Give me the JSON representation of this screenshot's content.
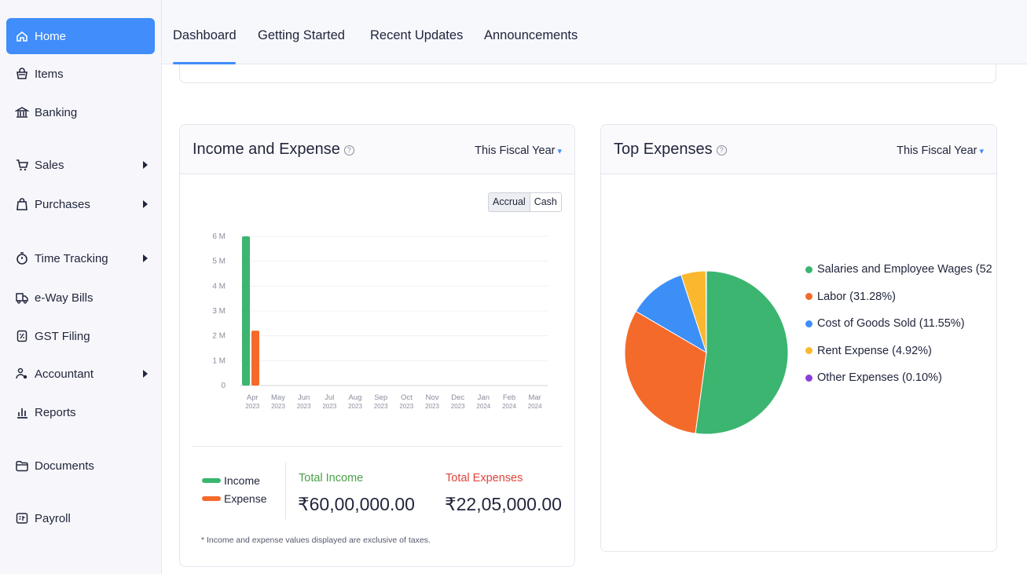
{
  "sidebar": {
    "items": [
      {
        "label": "Home",
        "icon": "home-icon",
        "active": true,
        "arrow": false
      },
      {
        "label": "Items",
        "icon": "basket-icon",
        "active": false,
        "arrow": false
      },
      {
        "label": "Banking",
        "icon": "bank-icon",
        "active": false,
        "arrow": false
      },
      {
        "label": "Sales",
        "icon": "cart-icon",
        "active": false,
        "arrow": true
      },
      {
        "label": "Purchases",
        "icon": "bag-icon",
        "active": false,
        "arrow": true
      },
      {
        "label": "Time Tracking",
        "icon": "stopwatch-icon",
        "active": false,
        "arrow": true
      },
      {
        "label": "e-Way Bills",
        "icon": "truck-icon",
        "active": false,
        "arrow": false
      },
      {
        "label": "GST Filing",
        "icon": "percent-doc-icon",
        "active": false,
        "arrow": false
      },
      {
        "label": "Accountant",
        "icon": "accountant-icon",
        "active": false,
        "arrow": true
      },
      {
        "label": "Reports",
        "icon": "bar-chart-icon",
        "active": false,
        "arrow": false
      },
      {
        "label": "Documents",
        "icon": "folder-icon",
        "active": false,
        "arrow": false
      },
      {
        "label": "Payroll",
        "icon": "payroll-icon",
        "active": false,
        "arrow": false
      }
    ]
  },
  "tabs": [
    "Dashboard",
    "Getting Started",
    "Recent Updates",
    "Announcements"
  ],
  "active_tab": "Dashboard",
  "income_card": {
    "title": "Income and Expense",
    "period": "This Fiscal Year",
    "toggle": [
      "Accrual",
      "Cash"
    ],
    "legend_income": "Income",
    "legend_expense": "Expense",
    "total_income_label": "Total Income",
    "total_income_value": "₹60,00,000.00",
    "total_expenses_label": "Total Expenses",
    "total_expenses_value": "₹22,05,000.00",
    "footnote": "* Income and expense values displayed are exclusive of taxes."
  },
  "expenses_card": {
    "title": "Top Expenses",
    "period": "This Fiscal Year"
  },
  "colors": {
    "accent": "#408dfb",
    "income": "#3bb56f",
    "expense": "#f46a2a",
    "income_label": "#4aa048",
    "expense_label": "#e0433a"
  },
  "chart_data": [
    {
      "type": "bar",
      "categories": [
        "Apr 2023",
        "May 2023",
        "Jun 2023",
        "Jul 2023",
        "Aug 2023",
        "Sep 2023",
        "Oct 2023",
        "Nov 2023",
        "Dec 2023",
        "Jan 2024",
        "Feb 2024",
        "Mar 2024"
      ],
      "series": [
        {
          "name": "Income",
          "color": "#3bb56f",
          "values": [
            6000000,
            0,
            0,
            0,
            0,
            0,
            0,
            0,
            0,
            0,
            0,
            0
          ]
        },
        {
          "name": "Expense",
          "color": "#f46a2a",
          "values": [
            2205000,
            0,
            0,
            0,
            0,
            0,
            0,
            0,
            0,
            0,
            0,
            0
          ]
        }
      ],
      "yticks": [
        "0",
        "1 M",
        "2 M",
        "3 M",
        "4 M",
        "5 M",
        "6 M"
      ],
      "xticks": [
        [
          "Apr",
          "2023"
        ],
        [
          "May",
          "2023"
        ],
        [
          "Jun",
          "2023"
        ],
        [
          "Jul",
          "2023"
        ],
        [
          "Aug",
          "2023"
        ],
        [
          "Sep",
          "2023"
        ],
        [
          "Oct",
          "2023"
        ],
        [
          "Nov",
          "2023"
        ],
        [
          "Dec",
          "2023"
        ],
        [
          "Jan",
          "2024"
        ],
        [
          "Feb",
          "2024"
        ],
        [
          "Mar",
          "2024"
        ]
      ],
      "ylim": [
        0,
        6000000
      ],
      "grid": true
    },
    {
      "type": "pie",
      "slices": [
        {
          "label": "Salaries and Employee Wages (52",
          "value": 52.15,
          "color": "#3bb56f"
        },
        {
          "label": "Labor (31.28%)",
          "value": 31.28,
          "color": "#f46a2a"
        },
        {
          "label": "Cost of Goods Sold (11.55%)",
          "value": 11.55,
          "color": "#3d8ff8"
        },
        {
          "label": "Rent Expense (4.92%)",
          "value": 4.92,
          "color": "#fbb82f"
        },
        {
          "label": "Other Expenses (0.10%)",
          "value": 0.1,
          "color": "#8b3fd9"
        }
      ]
    }
  ]
}
